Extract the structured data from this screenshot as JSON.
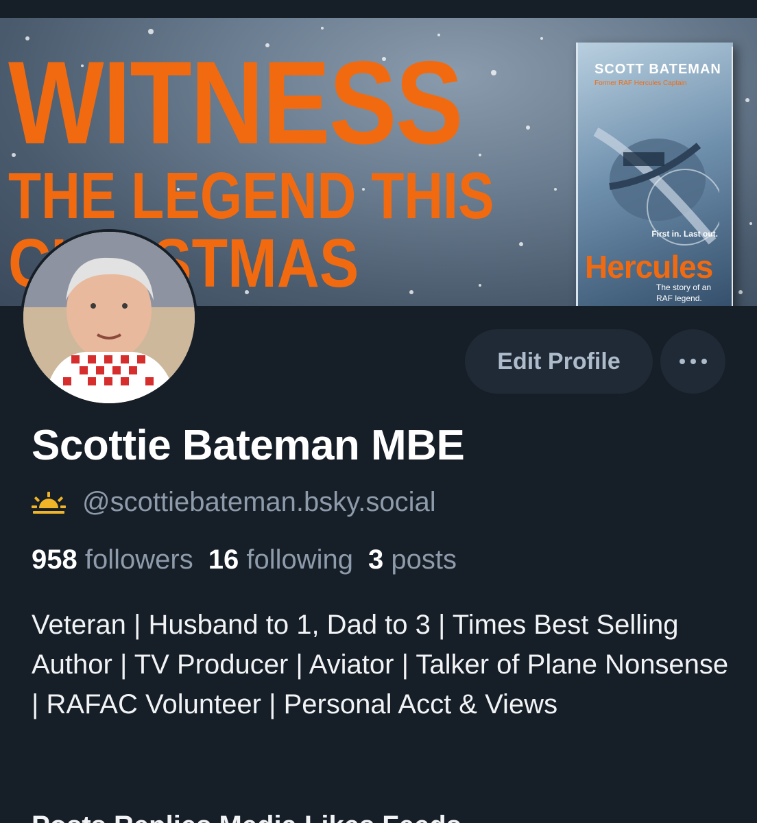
{
  "banner": {
    "headline_line1": "WITNESS",
    "headline_line2": "THE LEGEND THIS",
    "headline_line3": "CHRISTMAS",
    "book_author": "SCOTT BATEMAN",
    "book_subtitle": "Former RAF Hercules Captain",
    "book_tagline": "First in. Last out.",
    "book_title": "Hercules",
    "book_story": "The story of an RAF legend."
  },
  "actions": {
    "edit_profile_label": "Edit Profile"
  },
  "profile": {
    "display_name": "Scottie Bateman MBE",
    "handle": "@scottiebateman.bsky.social",
    "followers_count": "958",
    "followers_label": "followers",
    "following_count": "16",
    "following_label": "following",
    "posts_count": "3",
    "posts_label": "posts",
    "bio": "Veteran | Husband to 1, Dad to 3 | Times Best Selling Author | TV Producer | Aviator | Talker of Plane Nonsense | RAFAC Volunteer | Personal Acct & Views"
  },
  "tabs_partial": "Posts   Replies   Media   Likes   Feeds",
  "colors": {
    "background": "#161e27",
    "button_bg": "#1f2a36",
    "accent_orange": "#f26a10",
    "secondary_text": "#8e9bab",
    "sun_icon": "#f0b429"
  },
  "icons": {
    "handle_icon": "sunrise-icon",
    "more_icon": "ellipsis-icon"
  }
}
